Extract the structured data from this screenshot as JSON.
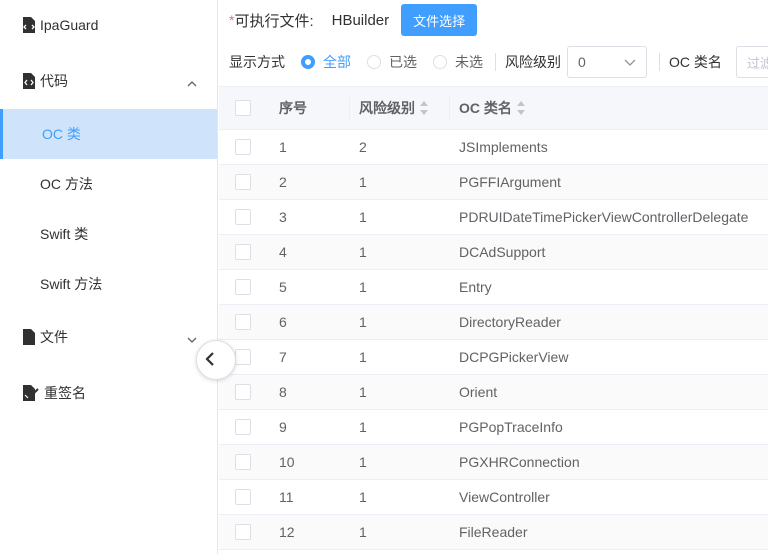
{
  "sidebar": {
    "items": [
      {
        "label": "IpaGuard",
        "icon": "code-file-icon"
      },
      {
        "label": "代码",
        "icon": "code-doc-icon",
        "expanded": true
      },
      {
        "label": "OC 类",
        "active": true
      },
      {
        "label": "OC 方法"
      },
      {
        "label": "Swift 类"
      },
      {
        "label": "Swift 方法"
      },
      {
        "label": "文件",
        "icon": "file-icon",
        "expanded": false
      },
      {
        "label": "重签名",
        "icon": "sign-icon"
      }
    ]
  },
  "header": {
    "required_mark": "*",
    "exe_label": "可执行文件:",
    "exe_value": "HBuilder",
    "file_select_button": "文件选择"
  },
  "filters": {
    "display_label": "显示方式",
    "options": [
      "全部",
      "已选",
      "未选"
    ],
    "selected_option": "全部",
    "risk_label": "风险级别",
    "risk_value": "0",
    "oc_label": "OC 类名",
    "filter_placeholder": "过滤"
  },
  "table": {
    "columns": [
      "序号",
      "风险级别",
      "OC 类名"
    ],
    "rows": [
      {
        "no": "1",
        "risk": "2",
        "name": "JSImplements"
      },
      {
        "no": "2",
        "risk": "1",
        "name": "PGFFIArgument"
      },
      {
        "no": "3",
        "risk": "1",
        "name": "PDRUIDateTimePickerViewControllerDelegate"
      },
      {
        "no": "4",
        "risk": "1",
        "name": "DCAdSupport"
      },
      {
        "no": "5",
        "risk": "1",
        "name": "Entry"
      },
      {
        "no": "6",
        "risk": "1",
        "name": "DirectoryReader"
      },
      {
        "no": "7",
        "risk": "1",
        "name": "DCPGPickerView"
      },
      {
        "no": "8",
        "risk": "1",
        "name": "Orient"
      },
      {
        "no": "9",
        "risk": "1",
        "name": "PGPopTraceInfo"
      },
      {
        "no": "10",
        "risk": "1",
        "name": "PGXHRConnection"
      },
      {
        "no": "11",
        "risk": "1",
        "name": "ViewController"
      },
      {
        "no": "12",
        "risk": "1",
        "name": "FileReader"
      }
    ]
  },
  "colors": {
    "accent": "#409eff",
    "active_bg": "#cfe3fb",
    "required": "#f56c6c"
  }
}
